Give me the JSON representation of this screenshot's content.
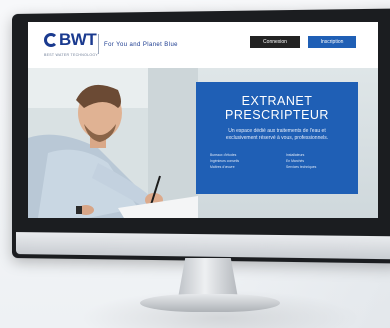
{
  "site": {
    "logo_text": "BWT",
    "logo_subtext": "BEST WATER TECHNOLOGY",
    "tagline": "For You and Planet Blue",
    "buttons": {
      "login": "Connexion",
      "signup": "Inscription"
    }
  },
  "hero": {
    "title_line1": "EXTRANET",
    "title_line2": "PRESCRIPTEUR",
    "description_line1": "Un espace dédié aux traitements de l'eau et",
    "description_line2": "exclusivement réservé à vous, professionnels.",
    "list_left": [
      "Bureaux d'études",
      "Ingénieurs conseils",
      "Maîtres d'œuvre"
    ],
    "list_right": [
      "Installateurs",
      "En Marchés",
      "Services techniques"
    ]
  },
  "colors": {
    "brand_blue": "#1f5fb5",
    "logo_blue": "#1a3a8f",
    "login_button": "#222222"
  }
}
